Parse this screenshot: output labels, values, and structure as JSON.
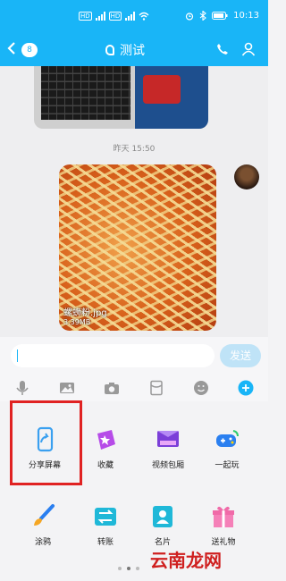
{
  "status_bar": {
    "time": "10:13"
  },
  "header": {
    "unread_count": "8",
    "title": "测试"
  },
  "chat": {
    "timestamp": "昨天 15:50",
    "image_message": {
      "file_name": "螺蛳粉.jpg",
      "file_size": "3.39MB"
    }
  },
  "input": {
    "placeholder": "",
    "value": "",
    "send_label": "发送"
  },
  "toolbar_icons": [
    "microphone-icon",
    "image-icon",
    "camera-icon",
    "red-packet-icon",
    "emoji-icon",
    "plus-icon"
  ],
  "panel": {
    "items": [
      {
        "label": "分享屏幕",
        "icon": "share-screen-icon"
      },
      {
        "label": "收藏",
        "icon": "favorite-icon"
      },
      {
        "label": "视频包厢",
        "icon": "video-room-icon"
      },
      {
        "label": "一起玩",
        "icon": "game-controller-icon"
      },
      {
        "label": "涂鸦",
        "icon": "paintbrush-icon"
      },
      {
        "label": "转账",
        "icon": "transfer-icon"
      },
      {
        "label": "名片",
        "icon": "contact-card-icon"
      },
      {
        "label": "送礼物",
        "icon": "gift-icon"
      }
    ]
  },
  "watermark": "云南龙网",
  "colors": {
    "accent": "#19b5f7",
    "highlight": "#e02222"
  }
}
